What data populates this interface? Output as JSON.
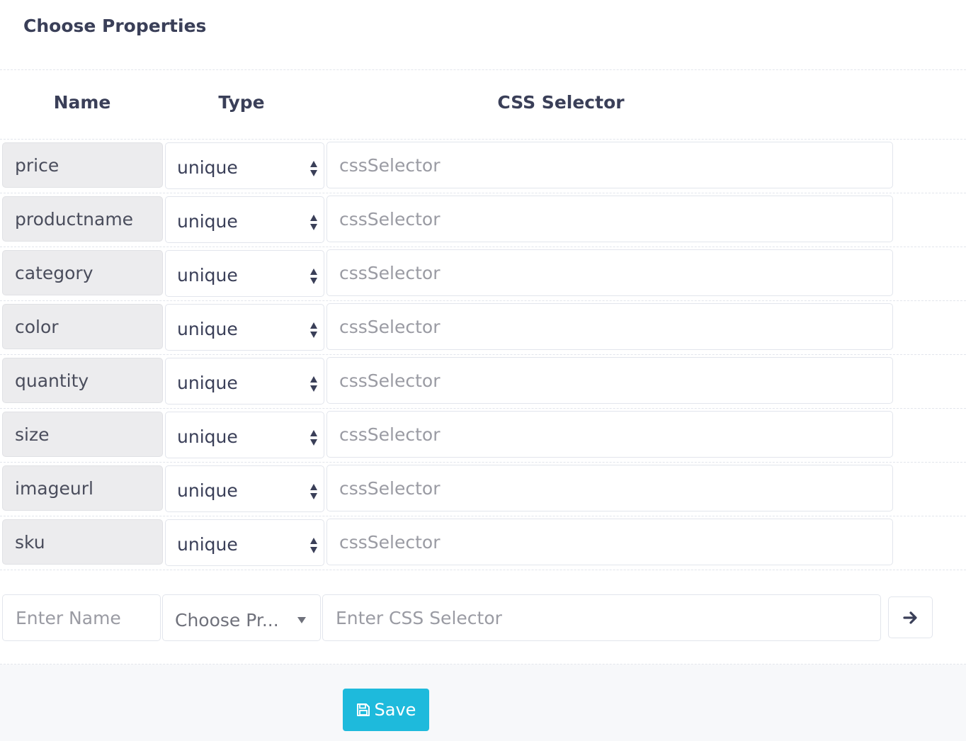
{
  "section": {
    "title": "Choose Properties"
  },
  "table": {
    "headers": {
      "name": "Name",
      "type": "Type",
      "css_selector": "CSS Selector"
    },
    "rows": [
      {
        "name": "price",
        "type": "unique",
        "css_placeholder": "cssSelector"
      },
      {
        "name": "productname",
        "type": "unique",
        "css_placeholder": "cssSelector"
      },
      {
        "name": "category",
        "type": "unique",
        "css_placeholder": "cssSelector"
      },
      {
        "name": "color",
        "type": "unique",
        "css_placeholder": "cssSelector"
      },
      {
        "name": "quantity",
        "type": "unique",
        "css_placeholder": "cssSelector"
      },
      {
        "name": "size",
        "type": "unique",
        "css_placeholder": "cssSelector"
      },
      {
        "name": "imageurl",
        "type": "unique",
        "css_placeholder": "cssSelector"
      },
      {
        "name": "sku",
        "type": "unique",
        "css_placeholder": "cssSelector"
      }
    ]
  },
  "new_property": {
    "name_placeholder": "Enter Name",
    "type_placeholder": "Choose Pr...",
    "css_placeholder": "Enter CSS Selector",
    "submit_icon": "arrow-right-icon"
  },
  "footer": {
    "save_label": "Save",
    "save_icon": "floppy-disk-icon"
  },
  "colors": {
    "accent": "#1ebadc",
    "heading": "#3a3f58",
    "name_cell_bg": "#ececee"
  }
}
